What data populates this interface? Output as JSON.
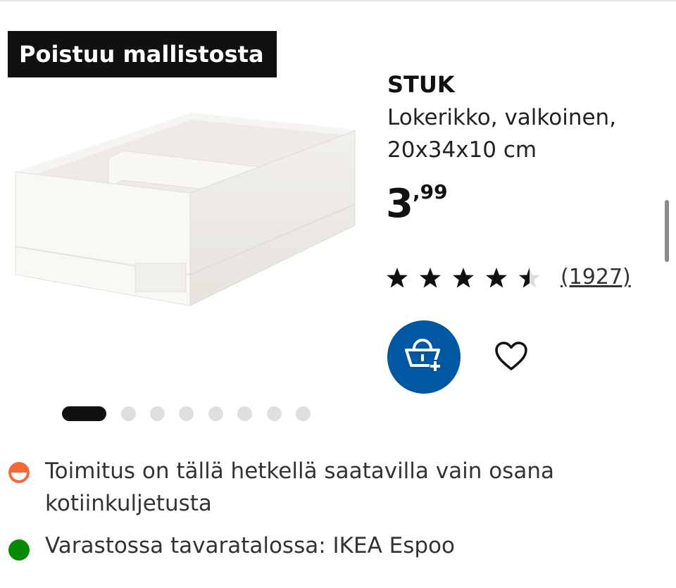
{
  "badge": {
    "label": "Poistuu mallistosta"
  },
  "product": {
    "name": "STUK",
    "description": "Lokerikko, valkoinen, 20x34x10 cm",
    "price": {
      "integer": "3",
      "decimals": ",99"
    },
    "rating": {
      "value": 4.5,
      "max": 5,
      "count_label": "(1927)"
    }
  },
  "gallery": {
    "image_count": 8,
    "active_index": 1
  },
  "actions": {
    "cart_icon": "basket-add-icon",
    "favorite_icon": "heart-icon"
  },
  "status": {
    "delivery": {
      "text": "Toimitus on tällä hetkellä saatavilla vain osana kotiinkuljetusta",
      "color": "#f26a38"
    },
    "stock": {
      "text": "Varastossa tavaratalossa: IKEA Espoo",
      "color": "#0a8a00"
    }
  },
  "colors": {
    "accent": "#0058a3",
    "badge_bg": "#111111"
  }
}
